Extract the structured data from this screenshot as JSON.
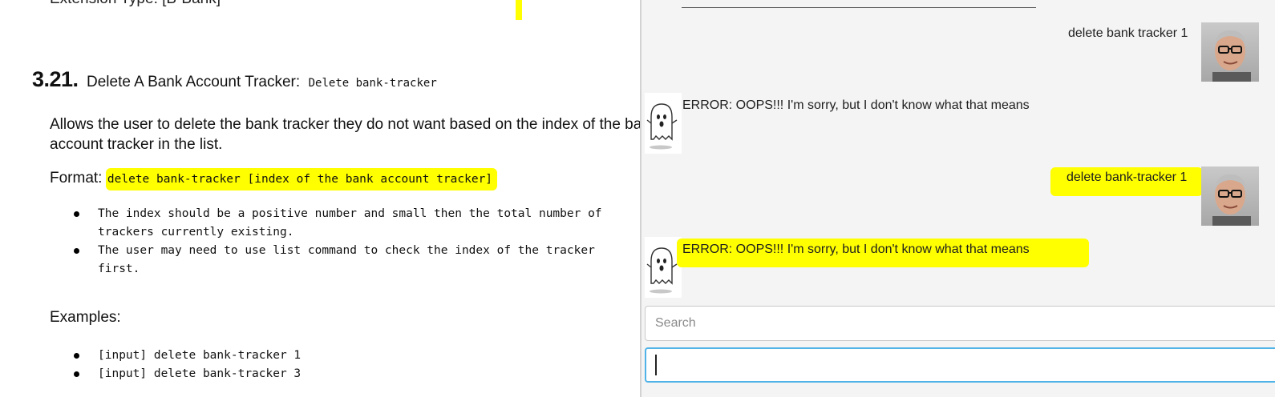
{
  "document": {
    "cut_off_line": "Extension Type: [B-Bank]",
    "section": {
      "number": "3.21.",
      "title": "Delete A Bank Account Tracker:",
      "command": "Delete bank-tracker"
    },
    "description": "Allows the user to delete the bank tracker they do not want based on the index of the bank account tracker in the list.",
    "format": {
      "label": "Format:",
      "syntax": "delete bank-tracker [index of the bank account tracker]"
    },
    "notes": [
      "The index should be a positive number and small then the total number of trackers currently existing.",
      "The user may need to use list command to check the index of the tracker first."
    ],
    "examples_heading": "Examples:",
    "examples": [
      "[input] delete bank-tracker 1",
      "[input] delete bank-tracker 3"
    ]
  },
  "chat": {
    "divider": "____________________________________________________________",
    "messages": [
      {
        "sender": "user",
        "text": "delete bank tracker 1",
        "highlighted": false
      },
      {
        "sender": "bot",
        "text": "ERROR: OOPS!!! I'm sorry, but I don't know what that means",
        "highlighted": false
      },
      {
        "sender": "user",
        "text": "delete bank-tracker 1",
        "highlighted": true
      },
      {
        "sender": "bot",
        "text": "ERROR: OOPS!!! I'm sorry, but I don't know what that means",
        "highlighted": true
      }
    ],
    "search": {
      "placeholder": "Search",
      "value": ""
    },
    "input": {
      "value": ""
    }
  },
  "colors": {
    "highlight": "#ffff00",
    "chat_background": "#f4f4f4",
    "input_focus_border": "#4fb3e8"
  },
  "icons": {
    "user_avatar": "person-photo-avatar",
    "bot_avatar": "ghost-icon"
  }
}
